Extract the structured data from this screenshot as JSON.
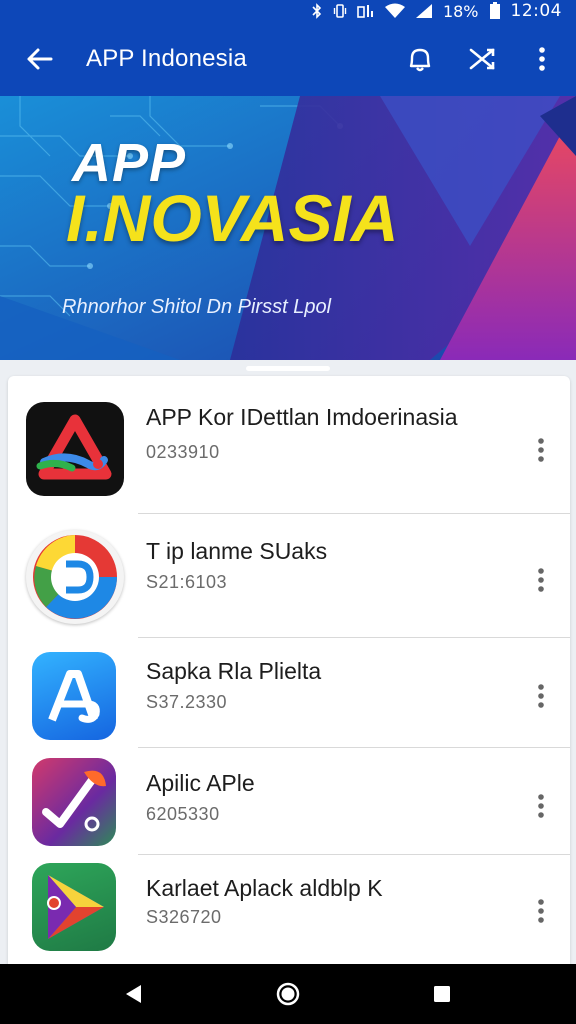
{
  "status_bar": {
    "battery": "18%",
    "time": "12:04"
  },
  "app_bar": {
    "title": "APP Indonesia",
    "icons": [
      "back-arrow-icon",
      "notification-icon",
      "shuffle-icon",
      "more-vert-icon"
    ]
  },
  "banner": {
    "line1": "APP",
    "line2": "I.NOVASIA",
    "subtitle": "Rhnorhor Shitol Dn Pirsst Lpol"
  },
  "apps": [
    {
      "name": "APP Kor IDettlan Imdoerinasia",
      "meta": "0233910",
      "icon": "red-triangle-app-icon"
    },
    {
      "name": "T ip lanme SUaks",
      "meta": "S21:6103",
      "icon": "circle-d-app-icon"
    },
    {
      "name": "Sapka Rla Plielta",
      "meta": "S37.2330",
      "icon": "letter-a-app-icon"
    },
    {
      "name": "Apilic APle",
      "meta": "6205330",
      "icon": "phone-feather-app-icon"
    },
    {
      "name": "Karlaet Aplack aldblp K",
      "meta": "S326720",
      "icon": "play-triangle-app-icon"
    }
  ],
  "nav_bar": {
    "icons": [
      "back-triangle-icon",
      "home-circle-icon",
      "recents-square-icon"
    ]
  },
  "colors": {
    "app_bar": "#0d47b8",
    "banner_yellow": "#f5e21b"
  }
}
